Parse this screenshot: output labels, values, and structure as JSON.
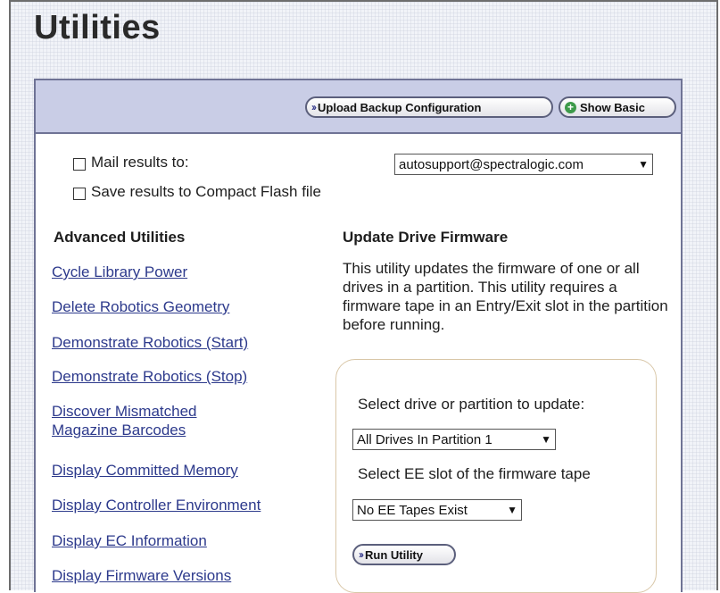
{
  "page": {
    "title": "Utilities"
  },
  "header": {
    "upload_label": "Upload Backup Configuration",
    "show_basic_label": "Show Basic"
  },
  "options": {
    "mail_label": "Mail results to:",
    "mail_value": "autosupport@spectralogic.com",
    "save_label": "Save results to Compact Flash file"
  },
  "advanced": {
    "heading": "Advanced Utilities",
    "items": [
      "Cycle Library Power",
      "Delete Robotics Geometry",
      "Demonstrate Robotics (Start)",
      "Demonstrate Robotics (Stop)",
      "Discover Mismatched",
      "Magazine Barcodes",
      "Display Committed Memory",
      "Display Controller Environment",
      "Display EC Information",
      "Display Firmware Versions"
    ]
  },
  "firmware": {
    "heading": "Update Drive Firmware",
    "description": "This utility updates the firmware of one or all drives in a partition. This utility requires a firmware tape in an Entry/Exit slot in the partition before running.",
    "select_drive_label": "Select drive or partition to update:",
    "drive_value": "All Drives In Partition 1",
    "select_slot_label": "Select EE slot of the firmware tape",
    "slot_value": "No EE Tapes Exist",
    "run_label": "Run Utility"
  }
}
